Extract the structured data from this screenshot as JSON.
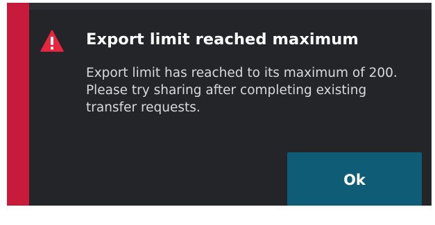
{
  "dialog": {
    "title": "Export limit reached maximum",
    "message": "Export limit has reached to its maximum of 200. Please try sharing after completing existing transfer requests.",
    "icon": "warning-icon",
    "ok_label": "Ok"
  },
  "colors": {
    "background": "#232528",
    "accent": "#c81b3c",
    "button": "#0f5c76",
    "title_text": "#ffffff",
    "body_text": "#d8dadd"
  }
}
